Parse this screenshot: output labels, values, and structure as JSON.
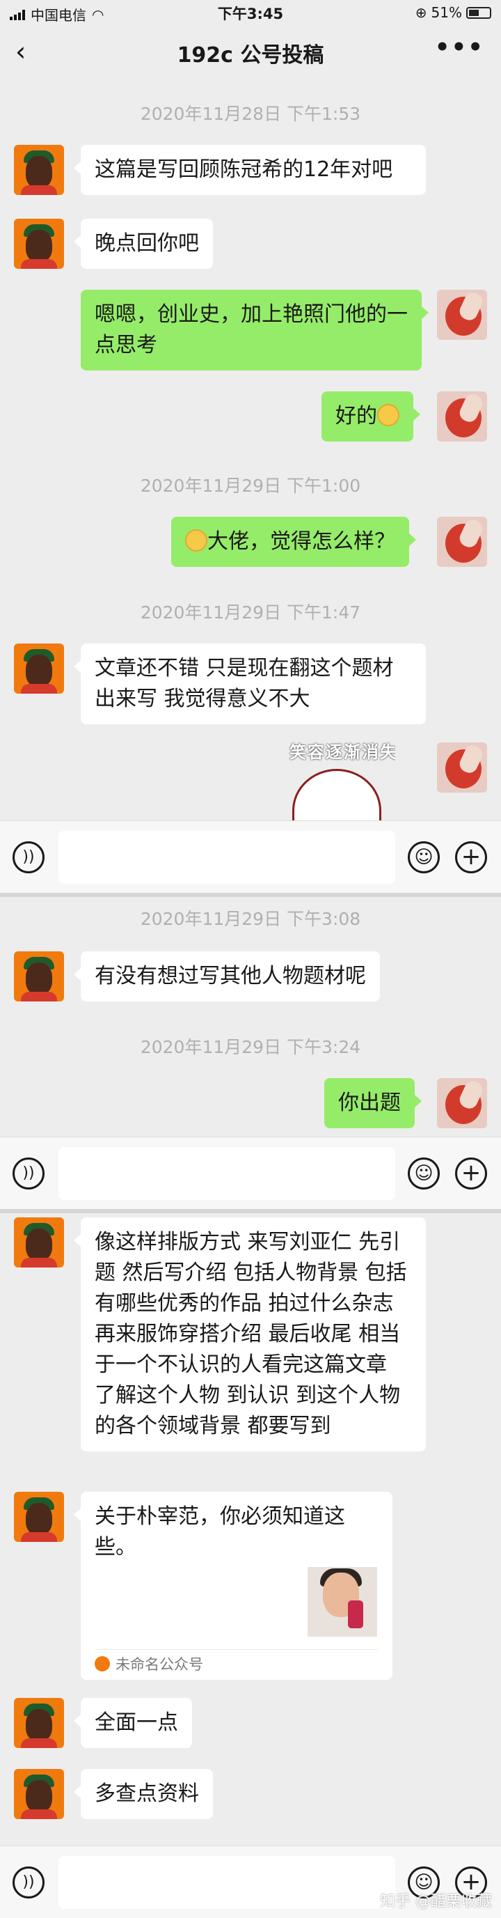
{
  "status_bar": {
    "carrier": "中国电信",
    "time": "下午3:45",
    "battery": "51%"
  },
  "header": {
    "back_icon": "chevron-left-icon",
    "title": "192c  公号投稿",
    "more": "•••"
  },
  "timestamps": [
    "2020年11月28日 下午1:53",
    "2020年11月29日 下午1:00",
    "2020年11月29日 下午1:47",
    "2020年11月29日 下午3:08",
    "2020年11月29日 下午3:24"
  ],
  "messages": [
    {
      "sender": "other",
      "text": "这篇是写回顾陈冠希的12年对吧"
    },
    {
      "sender": "other",
      "text": "晚点回你吧"
    },
    {
      "sender": "me",
      "text": "嗯嗯，创业史，加上艳照门他的一点思考"
    },
    {
      "sender": "me",
      "text": "好的"
    },
    {
      "sender": "me",
      "text": "大佬，觉得怎么样？"
    },
    {
      "sender": "other",
      "text": "文章还不错 只是现在翻这个题材出来写 我觉得意义不大"
    },
    {
      "sender": "other",
      "text": "有没有想过写其他人物题材呢"
    },
    {
      "sender": "me",
      "text": "你出题"
    },
    {
      "sender": "other",
      "text": "像这样排版方式 来写刘亚仁  先引题 然后写介绍 包括人物背景 包括有哪些优秀的作品 拍过什么杂志 再来服饰穿搭介绍 最后收尾 相当于一个不认识的人看完这篇文章 了解这个人物 到认识 到这个人物的各个领域背景 都要写到"
    },
    {
      "sender": "other",
      "text": "全面一点"
    },
    {
      "sender": "other",
      "text": "多查点资料"
    }
  ],
  "sticker": {
    "text": "笑容逐渐消失"
  },
  "link_card": {
    "title": "关于朴宰范，你必须知道这些。",
    "source": "未命名公众号"
  },
  "input_bar": {
    "voice_icon": "voice-icon",
    "emoji_icon": "emoji-icon",
    "plus_icon": "plus-icon"
  },
  "watermark": "知乎 @醋栗收藏"
}
